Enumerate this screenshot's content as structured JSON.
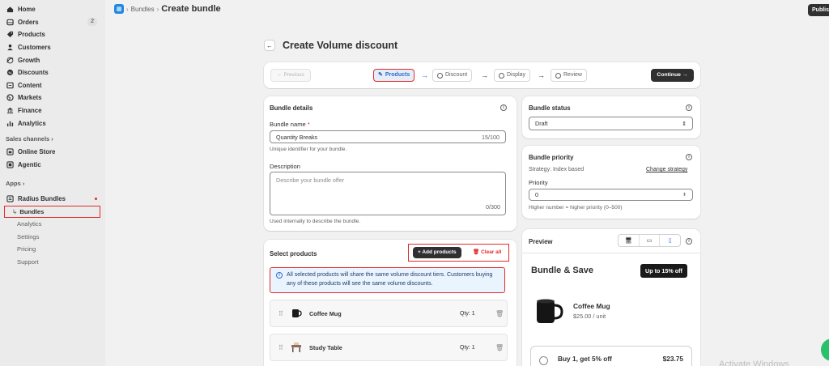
{
  "sidebar": {
    "items": [
      {
        "label": "Home",
        "icon": "home-icon"
      },
      {
        "label": "Orders",
        "icon": "orders-icon",
        "badge": "2"
      },
      {
        "label": "Products",
        "icon": "tag-icon"
      },
      {
        "label": "Customers",
        "icon": "person-icon"
      },
      {
        "label": "Growth",
        "icon": "growth-icon"
      },
      {
        "label": "Discounts",
        "icon": "discount-icon"
      },
      {
        "label": "Content",
        "icon": "content-icon"
      },
      {
        "label": "Markets",
        "icon": "globe-icon"
      },
      {
        "label": "Finance",
        "icon": "bank-icon"
      },
      {
        "label": "Analytics",
        "icon": "bar-chart-icon"
      }
    ],
    "sales_channels_label": "Sales channels",
    "channels": [
      {
        "label": "Online Store",
        "icon": "store-icon"
      },
      {
        "label": "Agentic",
        "icon": "agent-icon"
      }
    ],
    "apps_label": "Apps",
    "app_name": "Radius Bundles",
    "app_sub_items": [
      "Bundles",
      "Analytics",
      "Settings",
      "Pricing",
      "Support"
    ]
  },
  "header": {
    "breadcrumb_parent": "Bundles",
    "breadcrumb_current": "Create bundle",
    "publish_label": "Publis"
  },
  "page": {
    "title": "Create Volume discount"
  },
  "stepper": {
    "previous_label": "← Previous",
    "steps": [
      "Products",
      "Discount",
      "Display",
      "Review"
    ],
    "continue_label": "Continue →"
  },
  "bundle_details": {
    "title": "Bundle details",
    "name_label": "Bundle name",
    "name_value": "Quantity Breaks",
    "name_counter": "15/100",
    "name_help": "Unique identifier for your bundle.",
    "description_label": "Description",
    "description_placeholder": "Describe your bundle offer",
    "description_counter": "0/300",
    "description_help": "Used internally to describe the bundle."
  },
  "bundle_status": {
    "title": "Bundle status",
    "value": "Draft"
  },
  "bundle_priority": {
    "title": "Bundle priority",
    "strategy_text": "Strategy: Index based",
    "change_strategy_label": "Change strategy",
    "priority_label": "Priority",
    "priority_value": "0",
    "priority_help": "Higher number = higher priority (0–500)"
  },
  "select_products": {
    "title": "Select products",
    "add_label": "+ Add products",
    "clear_label": "Clear all",
    "info_text": "All selected products will share the same volume discount tiers. Customers buying any of these products will see the same volume discounts.",
    "products": [
      {
        "name": "Coffee Mug",
        "qty": "Qty: 1"
      },
      {
        "name": "Study Table",
        "qty": "Qty: 1"
      }
    ]
  },
  "preview": {
    "title": "Preview",
    "bundle_title": "Bundle & Save",
    "badge": "Up to 15% off",
    "product_name": "Coffee Mug",
    "product_price": "$25.00 / unit",
    "tier_label": "Buy 1, get 5% off",
    "tier_price": "$23.75"
  },
  "watermark": "Activate Windows",
  "colors": {
    "accent_red": "#e32b2b",
    "primary_dark": "#303030",
    "info_blue": "#2c6ecb"
  }
}
